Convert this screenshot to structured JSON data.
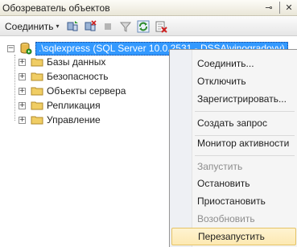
{
  "panel": {
    "title": "Обозреватель объектов",
    "pin_glyph": "⊸",
    "close_glyph": "✕"
  },
  "toolbar": {
    "connect_label": "Соединить",
    "connect_arrow": "▾",
    "icons": [
      "connect-server-icon",
      "disconnect-icon",
      "stop-icon",
      "filter-icon",
      "refresh-icon",
      "delete-filter-icon"
    ]
  },
  "tree": {
    "server": {
      "expander": "−",
      "label": ".\\sqlexpress (SQL Server 10.0.2531 - DSSA\\vinogradovv)"
    },
    "children": [
      {
        "label": "Базы данных",
        "expander": "+"
      },
      {
        "label": "Безопасность",
        "expander": "+"
      },
      {
        "label": "Объекты сервера",
        "expander": "+"
      },
      {
        "label": "Репликация",
        "expander": "+"
      },
      {
        "label": "Управление",
        "expander": "+"
      }
    ]
  },
  "context_menu": {
    "items": [
      {
        "label": "Соединить...",
        "enabled": true
      },
      {
        "label": "Отключить",
        "enabled": true
      },
      {
        "label": "Зарегистрировать...",
        "enabled": true
      },
      {
        "label": "Создать запрос",
        "enabled": true
      },
      {
        "label": "Монитор активности",
        "enabled": true
      },
      {
        "label": "Запустить",
        "enabled": false
      },
      {
        "label": "Остановить",
        "enabled": true
      },
      {
        "label": "Приостановить",
        "enabled": true
      },
      {
        "label": "Возобновить",
        "enabled": false
      },
      {
        "label": "Перезапустить",
        "enabled": true,
        "highlighted": true
      }
    ]
  },
  "colors": {
    "selection": "#3399ff",
    "folder": "#e8c45a",
    "menu_highlight": "#fde9b2"
  }
}
